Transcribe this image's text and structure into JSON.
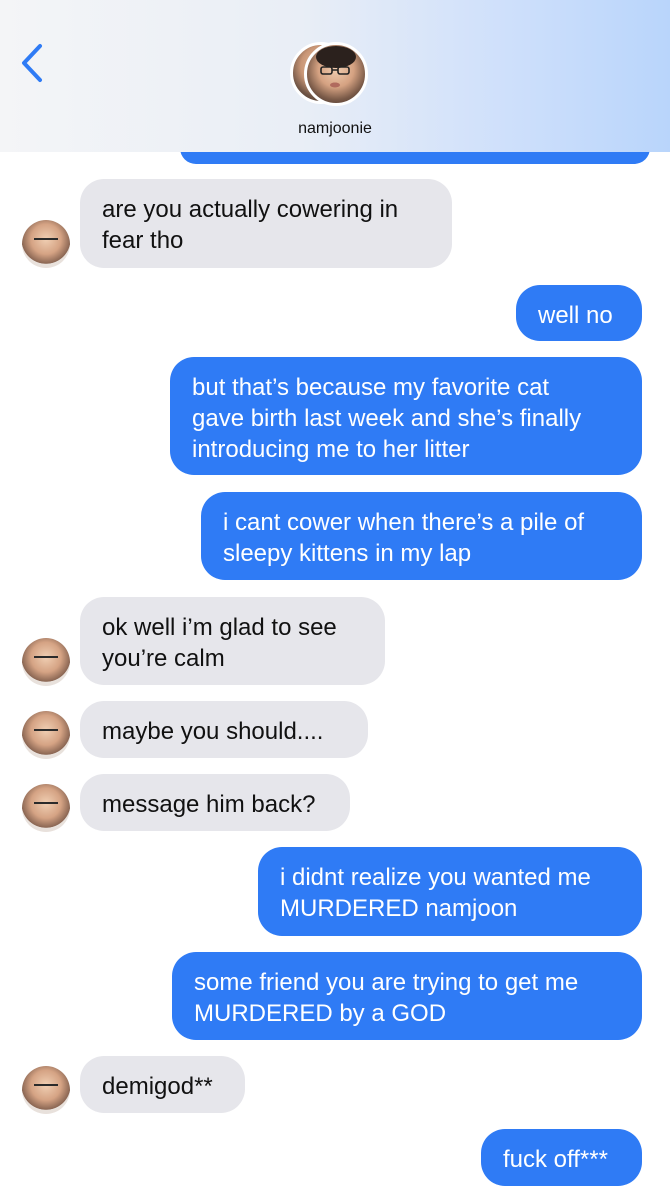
{
  "header": {
    "back_icon": "chevron-left-icon",
    "contact_name": "namjoonie",
    "accent_color": "#2f7bf5"
  },
  "messages": [
    {
      "from": "them",
      "lines": [
        "are you actually cowering in",
        "fear tho"
      ]
    },
    {
      "from": "me",
      "lines": [
        "well no"
      ]
    },
    {
      "from": "me",
      "lines": [
        "but that’s because my favorite cat",
        "gave birth last week and she’s finally",
        "introducing me to her litter"
      ]
    },
    {
      "from": "me",
      "lines": [
        "i cant cower when there’s a pile of",
        "sleepy kittens in my lap"
      ]
    },
    {
      "from": "them",
      "lines": [
        "ok well i’m glad to see",
        "you’re calm"
      ]
    },
    {
      "from": "them",
      "lines": [
        "maybe you should...."
      ]
    },
    {
      "from": "them",
      "lines": [
        "message him back?"
      ]
    },
    {
      "from": "me",
      "lines": [
        "i didnt realize you wanted me",
        "MURDERED namjoon"
      ]
    },
    {
      "from": "me",
      "lines": [
        "some friend you are trying to get me",
        "MURDERED by a GOD"
      ]
    },
    {
      "from": "them",
      "lines": [
        "demigod**"
      ]
    },
    {
      "from": "me",
      "lines": [
        "fuck off***"
      ]
    }
  ],
  "colors": {
    "incoming_bubble": "#e6e6eb",
    "outgoing_bubble": "#2f7bf5"
  }
}
